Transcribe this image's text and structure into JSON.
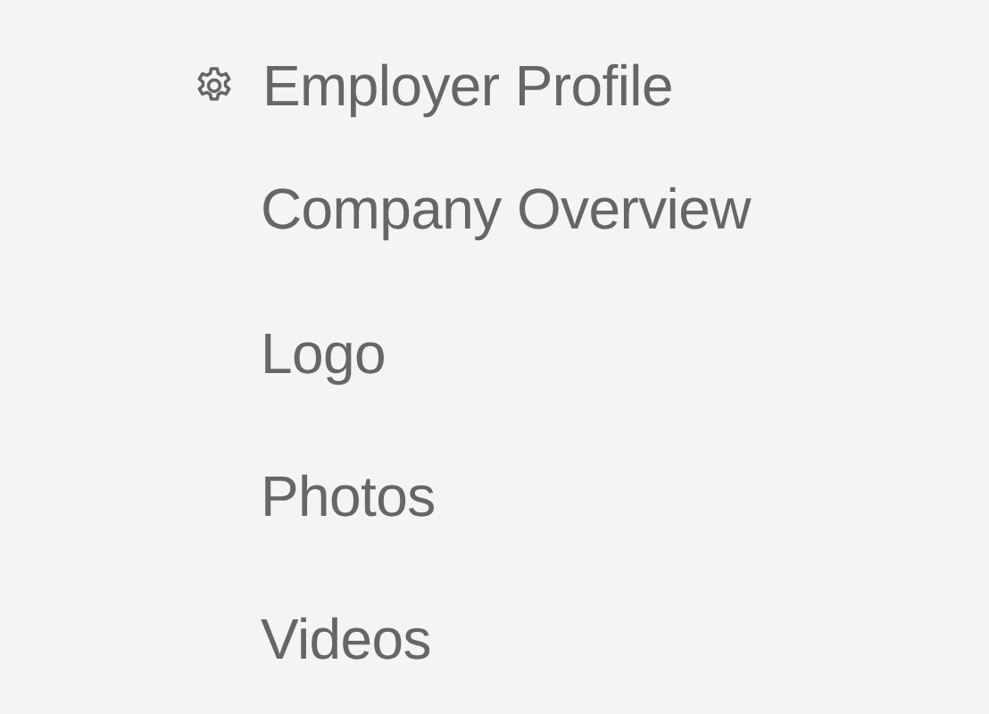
{
  "menu": {
    "header": {
      "label": "Employer Profile"
    },
    "items": [
      {
        "label": "Company Overview"
      },
      {
        "label": "Logo"
      },
      {
        "label": "Photos"
      },
      {
        "label": "Videos"
      }
    ]
  }
}
